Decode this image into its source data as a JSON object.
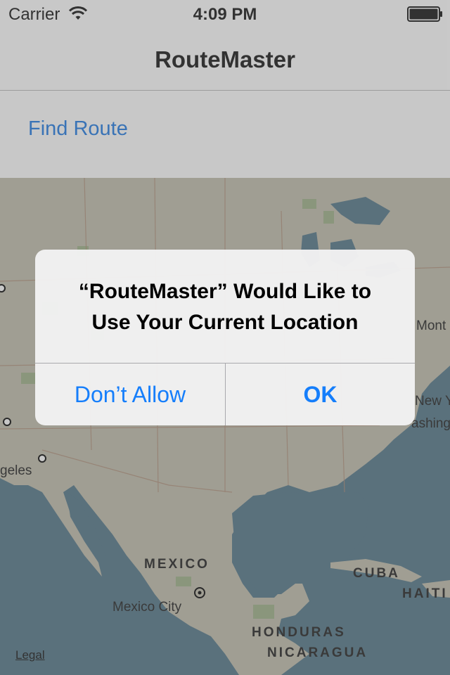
{
  "status_bar": {
    "carrier": "Carrier",
    "time": "4:09 PM"
  },
  "nav": {
    "title": "RouteMaster"
  },
  "toolbar": {
    "find_route_label": "Find Route"
  },
  "map": {
    "labels": {
      "mexico": "MEXICO",
      "mexico_city": "Mexico City",
      "cuba": "CUBA",
      "haiti": "HAITI",
      "honduras": "HONDURAS",
      "nicaragua": "NICARAGUA",
      "montreal": "Mont",
      "new_york": "New Y",
      "washington": "ashingt",
      "los_angeles": "geles"
    },
    "legal": "Legal"
  },
  "alert": {
    "title_line1": "“RouteMaster” Would Like to",
    "title_line2": "Use Your Current Location",
    "cancel_label": "Don’t Allow",
    "ok_label": "OK"
  }
}
